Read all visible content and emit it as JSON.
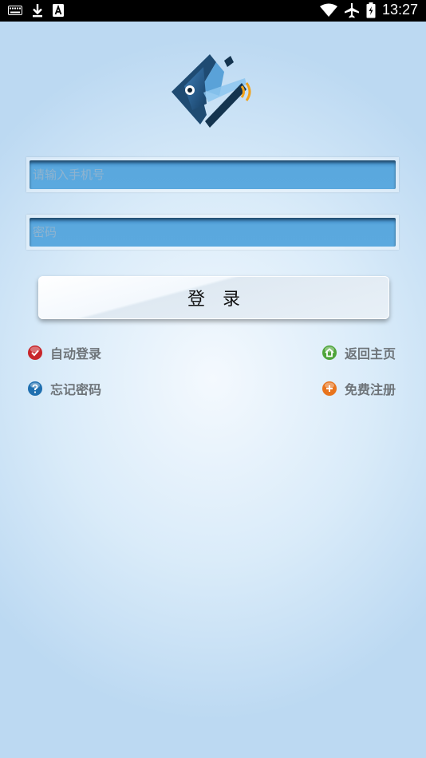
{
  "status_bar": {
    "time": "13:27",
    "left_icons": [
      "keyboard-icon",
      "download-icon",
      "text-a-icon"
    ],
    "right_icons": [
      "wifi-icon",
      "airplane-icon",
      "battery-icon"
    ]
  },
  "login_form": {
    "phone_placeholder": "请输入手机号",
    "password_placeholder": "密码",
    "login_label": "登录"
  },
  "links": {
    "auto_login": "自动登录",
    "back_home": "返回主页",
    "forgot_password": "忘记密码",
    "free_register": "免费注册"
  },
  "colors": {
    "field_blue": "#5aa8de",
    "auto_login_red": "#c8262b",
    "home_green": "#4fa53a",
    "forgot_blue": "#1f6fb0",
    "register_orange": "#e8741d"
  }
}
